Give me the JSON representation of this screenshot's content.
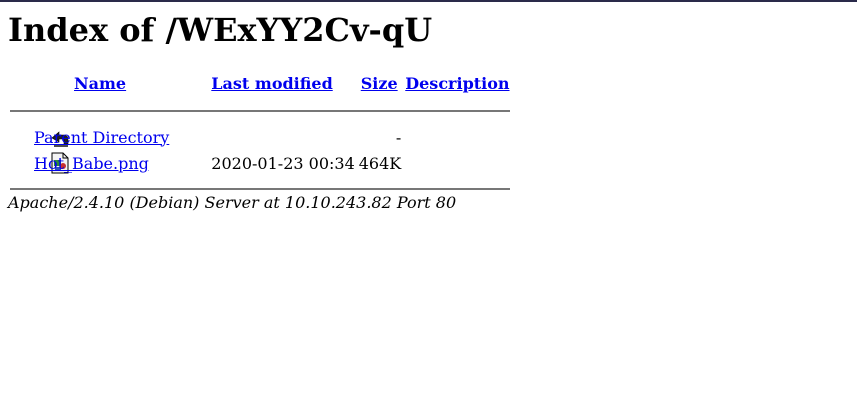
{
  "page": {
    "title": "Index of /WExYY2Cv-qU"
  },
  "columns": {
    "name": "Name",
    "last_modified": "Last modified",
    "size": "Size",
    "description": "Description"
  },
  "rows": [
    {
      "icon": "back-icon",
      "name": "Parent Directory",
      "last_modified": "",
      "size": "-",
      "description": ""
    },
    {
      "icon": "image-file-icon",
      "name": "Hot_Babe.png",
      "last_modified": "2020-01-23 00:34",
      "size": "464K",
      "description": ""
    }
  ],
  "footer": {
    "address": "Apache/2.4.10 (Debian) Server at 10.10.243.82 Port 80"
  },
  "colors": {
    "link": "#0000ee",
    "rule": "#777777"
  }
}
